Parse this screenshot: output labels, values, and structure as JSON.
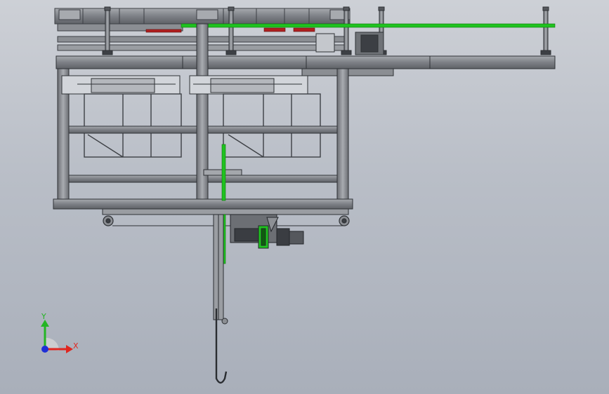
{
  "viewport": {
    "background_top": "#cdd0d6",
    "background_bottom": "#a9afba"
  },
  "model": {
    "frame_color": "#4a4d52",
    "steel_fill": "#8b8e93",
    "highlight_color": "#1fc21f",
    "accent_color": "#b01f1f"
  },
  "triad": {
    "x_label": "X",
    "y_label": "Y",
    "x_color": "#e0261f",
    "y_color": "#24b524",
    "z_color": "#1f2fd6"
  }
}
